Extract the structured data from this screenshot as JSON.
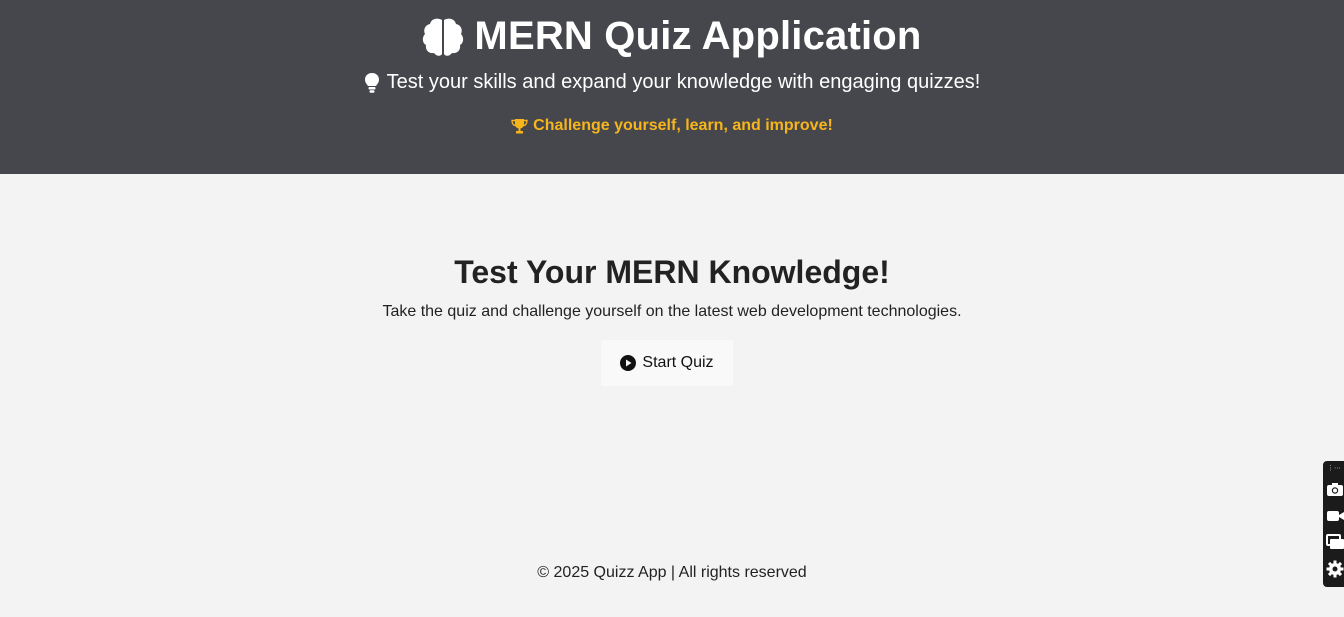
{
  "header": {
    "title": "MERN Quiz Application",
    "subtitle": "Test your skills and expand your knowledge with engaging quizzes!",
    "tagline": "Challenge yourself, learn, and improve!",
    "title_icon": "brain-icon",
    "subtitle_icon": "lightbulb-icon",
    "tagline_icon": "trophy-icon",
    "tagline_color": "#f6b51b",
    "background": "#46474c"
  },
  "hero": {
    "heading": "Test Your MERN Knowledge!",
    "description": "Take the quiz and challenge yourself on the latest web development technologies.",
    "start_button_label": "Start Quiz",
    "start_button_icon": "play-circle-icon"
  },
  "footer": {
    "text": "© 2025 Quizz App | All rights reserved"
  },
  "side_toolbar": {
    "icons": [
      "camera-icon",
      "video-icon",
      "screen-icon",
      "settings-icon"
    ]
  }
}
